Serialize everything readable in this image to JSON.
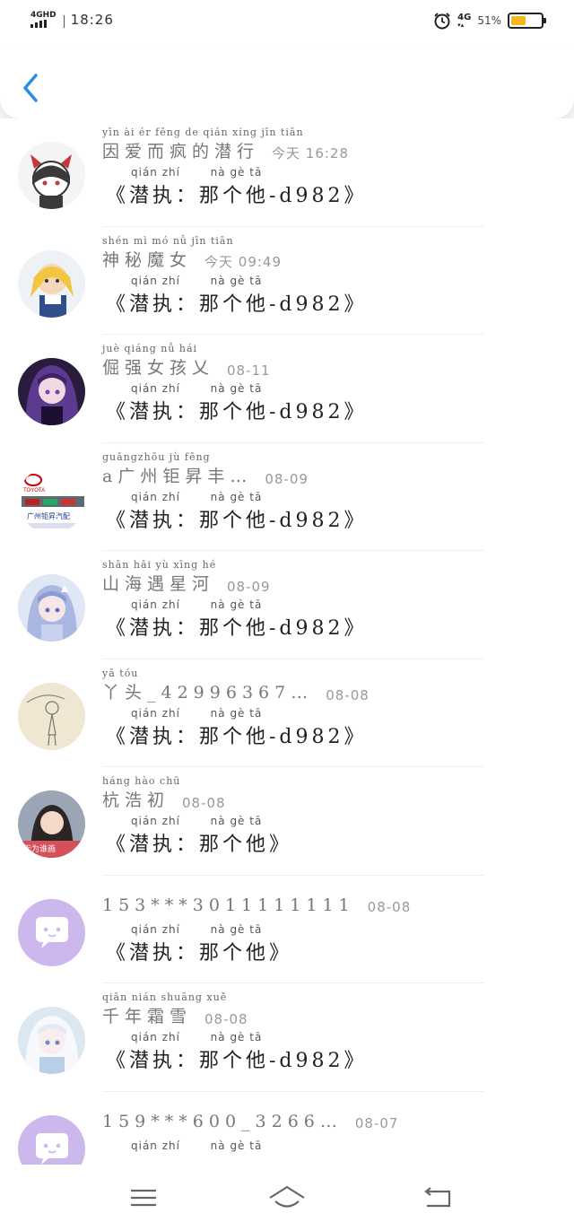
{
  "status_bar": {
    "network_top": "4GHD",
    "time": "18:26",
    "network_right": "4G",
    "battery_text": "51%",
    "battery_level": 0.51,
    "battery_color": "#f5b81c"
  },
  "header": {
    "back_icon": "chevron-left-icon",
    "accent_color": "#2a8ce6"
  },
  "list": [
    {
      "name_pinyin": "yīn ài ér fēng de qián xíng    jīn tiān",
      "name": "因爱而疯的潜行",
      "date_pinyin_today": true,
      "date": "今天 16:28",
      "msg_pinyin": "qián zhí       nà gè tā",
      "message": "《潜执：那个他-d982》"
    },
    {
      "name_pinyin": "shén mì mó nǚ      jīn tiān",
      "name": "神秘魔女",
      "date": "今天 09:49",
      "msg_pinyin": "qián zhí       nà gè tā",
      "message": "《潜执：那个他-d982》"
    },
    {
      "name_pinyin": "juè qiáng nǚ hái",
      "name": "倔强女孩乂",
      "date": "08-11",
      "msg_pinyin": "qián zhí       nà gè tā",
      "message": "《潜执：那个他-d982》"
    },
    {
      "name_pinyin": "guǎngzhōu jù    fēng",
      "name": "a广州钜昇丰…",
      "date": "08-09",
      "msg_pinyin": "qián zhí       nà gè tā",
      "message": "《潜执：那个他-d982》"
    },
    {
      "name_pinyin": "shān hǎi yù xīng hé",
      "name": "山海遇星河",
      "date": "08-09",
      "msg_pinyin": "qián zhí       nà gè tā",
      "message": "《潜执：那个他-d982》"
    },
    {
      "name_pinyin": "yā tóu",
      "name": "丫头_42996367…",
      "date": "08-08",
      "msg_pinyin": "qián zhí       nà gè tā",
      "message": "《潜执：那个他-d982》"
    },
    {
      "name_pinyin": "háng hào chū",
      "name": "杭浩初",
      "date": "08-08",
      "msg_pinyin": "qián zhí       nà gè tā",
      "message": "《潜执：那个他》"
    },
    {
      "name_pinyin": "",
      "name": "153***3011111111",
      "date": "08-08",
      "msg_pinyin": "qián zhí       nà gè tā",
      "message": "《潜执：那个他》"
    },
    {
      "name_pinyin": "qiān nián shuāng xuě",
      "name": "千年霜雪",
      "date": "08-08",
      "msg_pinyin": "qián zhí       nà gè tā",
      "message": "《潜执：那个他-d982》"
    },
    {
      "name_pinyin": "",
      "name": "159***600_3266…",
      "date": "08-07",
      "msg_pinyin": "qián zhí       nà gè tā",
      "message": ""
    }
  ],
  "avatars": [
    "devil-girl-avatar",
    "blonde-girl-avatar",
    "purple-hair-girl-avatar",
    "toyota-logo-avatar",
    "blue-hair-girl-avatar",
    "sketch-girl-avatar",
    "photo-girl-avatar",
    "default-chat-avatar",
    "white-hair-girl-avatar",
    "default-chat-avatar"
  ],
  "nav": {
    "menu_icon": "menu-icon",
    "home_icon": "home-icon",
    "back_icon": "back-icon"
  }
}
